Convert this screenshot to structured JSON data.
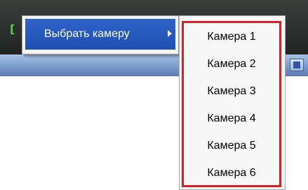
{
  "menu": {
    "item_label": "Выбрать камеру"
  },
  "submenu": {
    "items": [
      {
        "label": "Камера 1"
      },
      {
        "label": "Камера 2"
      },
      {
        "label": "Камера 3"
      },
      {
        "label": "Камера 4"
      },
      {
        "label": "Камера 5"
      },
      {
        "label": "Камера 6"
      }
    ]
  },
  "colors": {
    "menu_highlight": "#1f4fb2",
    "submenu_highlight_border": "#d42027"
  },
  "icons": {
    "submenu_arrow": "chevron-right-icon"
  }
}
